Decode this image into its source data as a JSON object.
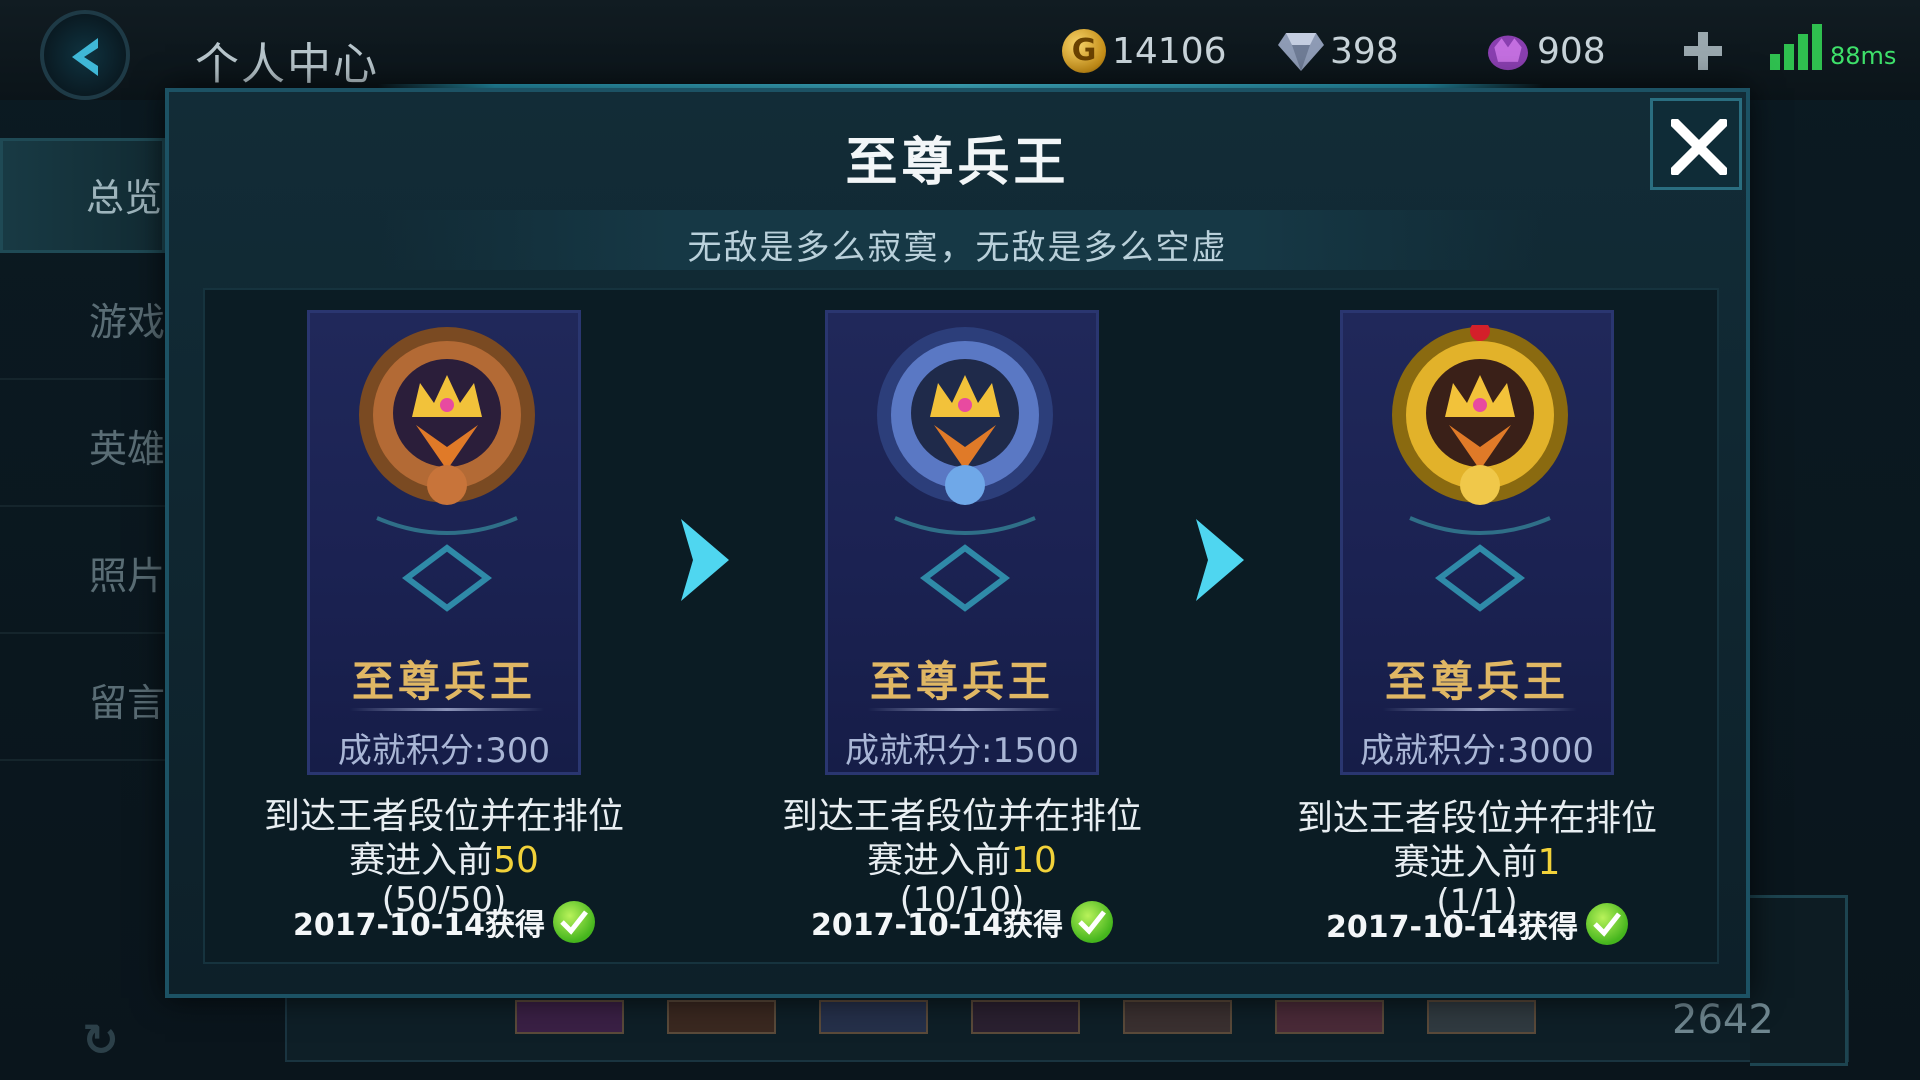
{
  "topbar": {
    "title": "个人中心",
    "gold": "14106",
    "diamonds": "398",
    "crystals": "908",
    "ping": "88ms",
    "colors": {
      "gold": "#e0a922",
      "ping": "#3ee06a"
    }
  },
  "sidebar": {
    "items": [
      {
        "label": "总览",
        "active": true
      },
      {
        "label": "游戏"
      },
      {
        "label": "英雄"
      },
      {
        "label": "照片"
      },
      {
        "label": "留言"
      }
    ]
  },
  "background": {
    "score": "2642"
  },
  "modal": {
    "title": "至尊兵王",
    "subtitle": "无敌是多么寂寞，无敌是多么空虚",
    "cards": [
      {
        "name": "至尊兵王",
        "points": "成就积分:300",
        "desc_prefix": "到达王者段位并在排位赛进入前",
        "desc_value": "50",
        "progress": "(50/50)",
        "date": "2017-10-14获得",
        "tier": "bronze",
        "completed": true
      },
      {
        "name": "至尊兵王",
        "points": "成就积分:1500",
        "desc_prefix": "到达王者段位并在排位赛进入前",
        "desc_value": "10",
        "progress": "(10/10)",
        "date": "2017-10-14获得",
        "tier": "silver",
        "completed": true
      },
      {
        "name": "至尊兵王",
        "points": "成就积分:3000",
        "desc_prefix": "到达王者段位并在排位赛进入前",
        "desc_value": "1",
        "progress": "(1/1)",
        "date": "2017-10-14获得",
        "tier": "gold",
        "completed": true
      }
    ],
    "colors": {
      "accent": "#4fd6f0",
      "highlight": "#f2d23a",
      "card_title": "#e0b764"
    }
  },
  "icons": {
    "back": "back-arrow-icon",
    "close": "close-icon",
    "plus": "plus-icon",
    "gold": "gold-coin-icon",
    "diamond": "diamond-icon",
    "crystal": "crystal-icon",
    "signal": "signal-icon",
    "check": "check-icon",
    "next": "chevron-right-icon"
  }
}
